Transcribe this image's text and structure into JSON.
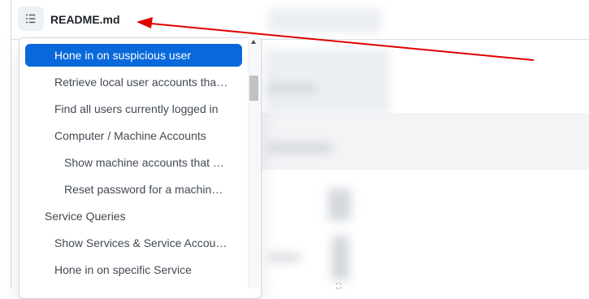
{
  "header": {
    "file_name": "README.md",
    "toc_icon": "list-unordered-icon"
  },
  "toc": {
    "items": [
      {
        "label": "Hone in on suspicious user",
        "level": 2,
        "active": true
      },
      {
        "label": "Retrieve local user accounts tha…",
        "level": 2,
        "active": false
      },
      {
        "label": "Find all users currently logged in",
        "level": 2,
        "active": false
      },
      {
        "label": "Computer / Machine Accounts",
        "level": 2,
        "active": false
      },
      {
        "label": "Show machine accounts that …",
        "level": 3,
        "active": false
      },
      {
        "label": "Reset password for a machin…",
        "level": 3,
        "active": false
      },
      {
        "label": "Service Queries",
        "level": 1,
        "active": false
      },
      {
        "label": "Show Services & Service Accou…",
        "level": 2,
        "active": false
      },
      {
        "label": "Hone in on specific Service",
        "level": 2,
        "active": false
      }
    ]
  },
  "annotation": {
    "color": "#e00000"
  },
  "colors": {
    "active_bg": "#0969da",
    "text": "#424a53"
  }
}
